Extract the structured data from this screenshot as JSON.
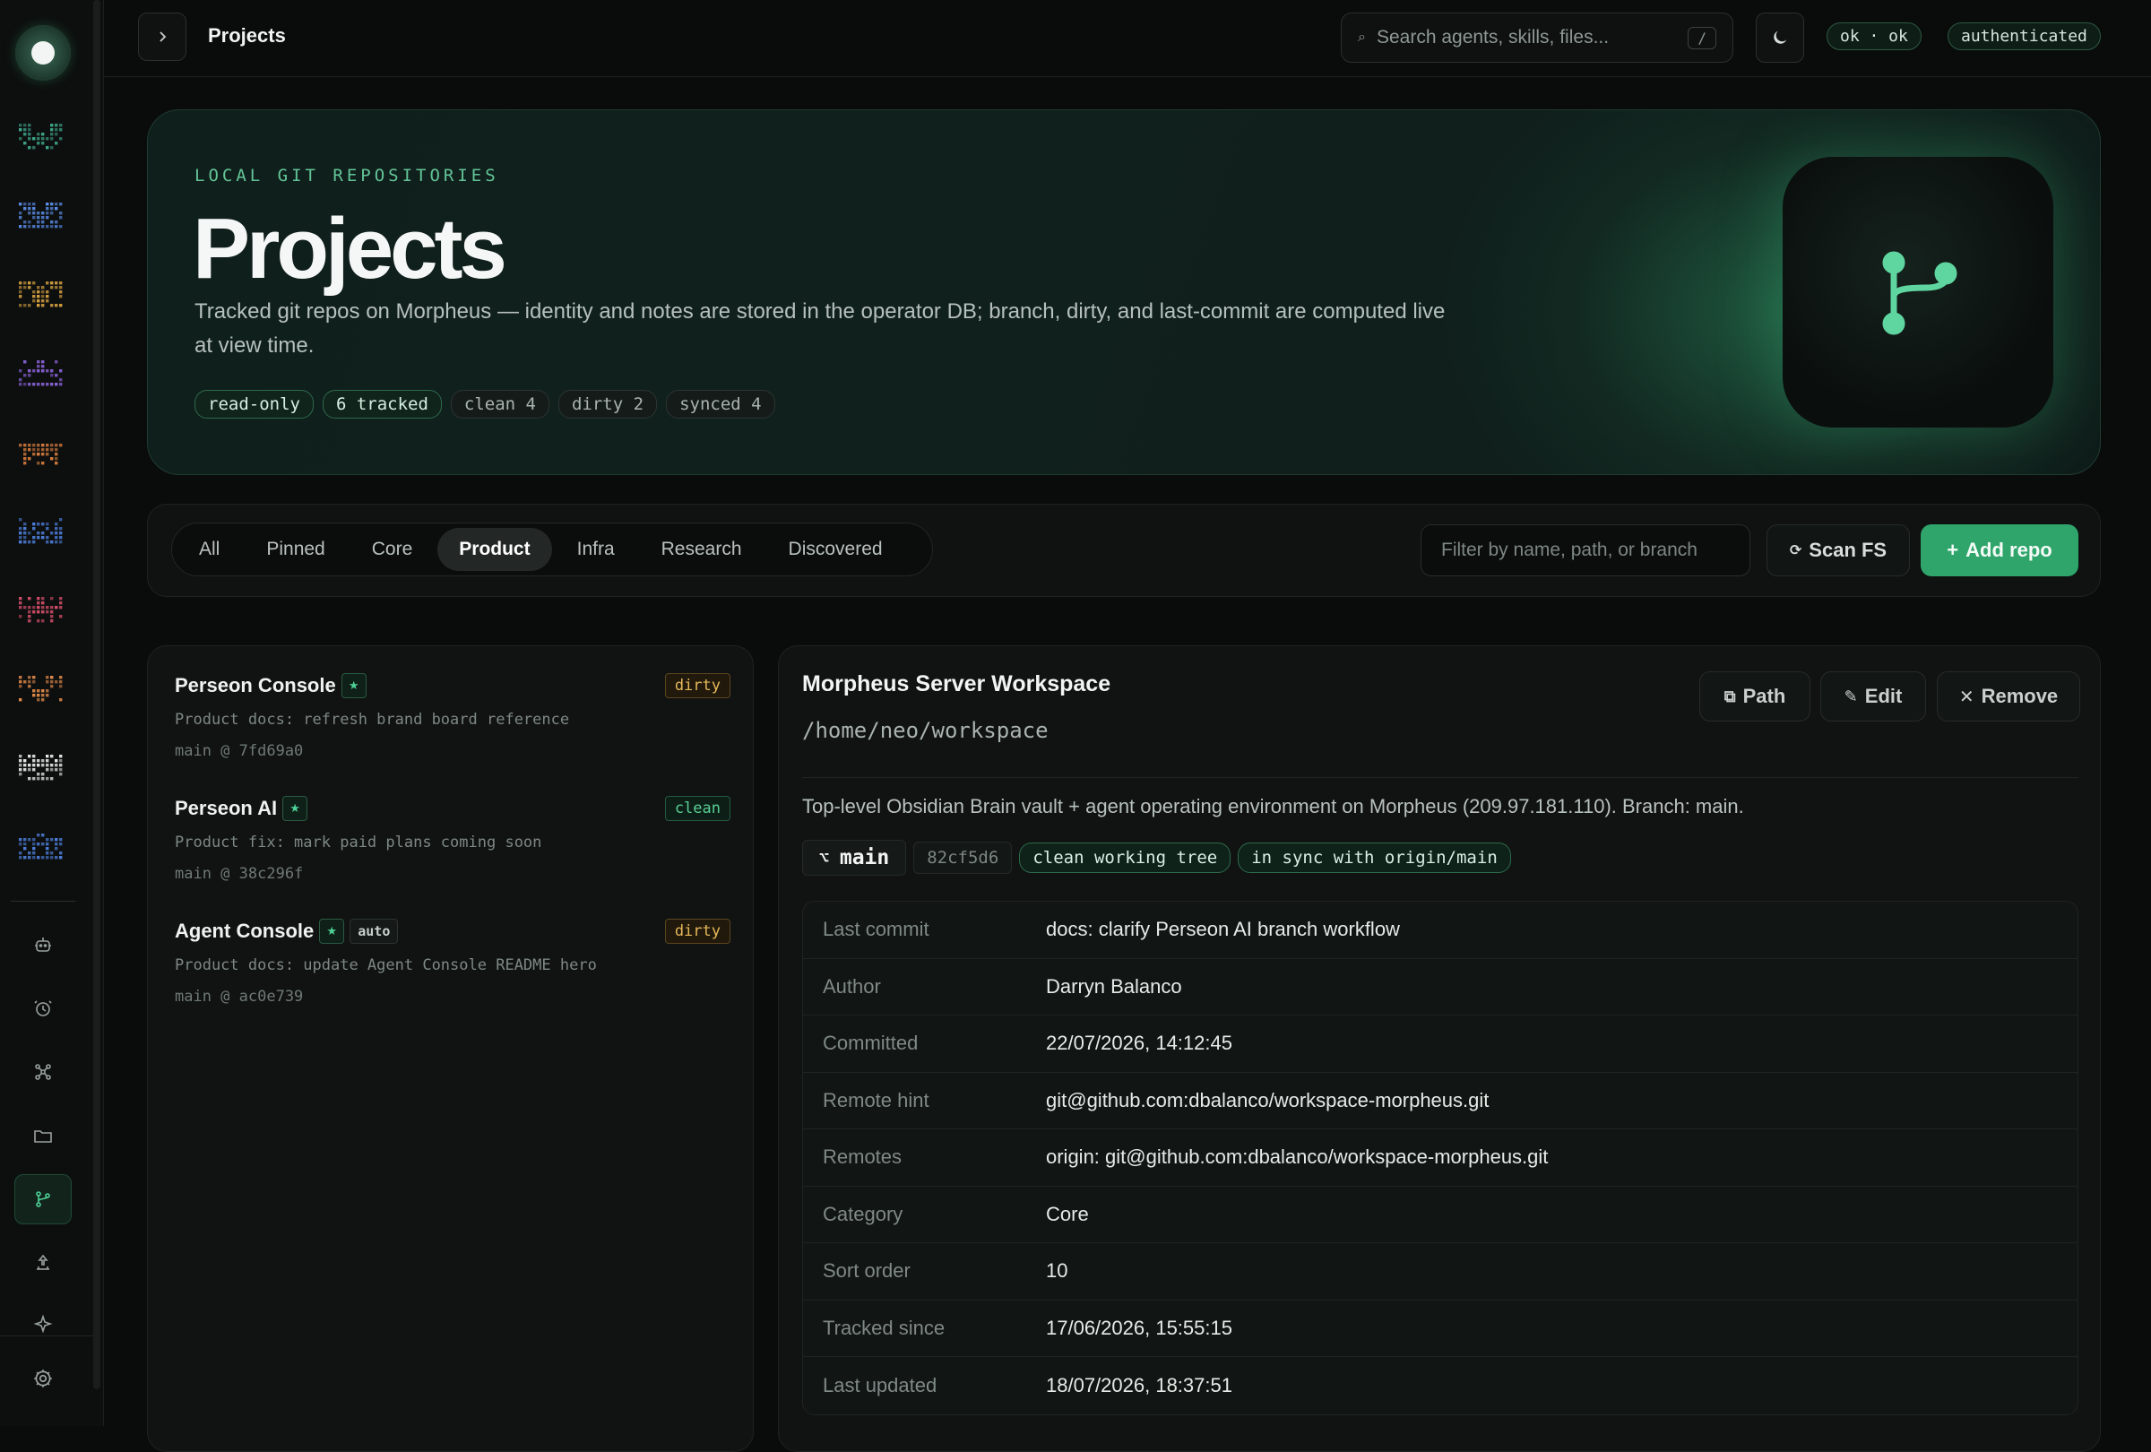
{
  "topbar": {
    "title": "Projects",
    "search_placeholder": "Search agents, skills, files...",
    "search_shortcut": "/",
    "status_ok": "ok · ok",
    "status_auth": "authenticated"
  },
  "hero": {
    "eyebrow": "LOCAL GIT REPOSITORIES",
    "title": "Projects",
    "description": "Tracked git repos on Morpheus — identity and notes are stored in the operator DB; branch, dirty, and last-commit are computed live at view time.",
    "chips": [
      "read-only",
      "6 tracked",
      "clean 4",
      "dirty 2",
      "synced 4"
    ]
  },
  "filters": {
    "tabs": [
      "All",
      "Pinned",
      "Core",
      "Product",
      "Infra",
      "Research",
      "Discovered"
    ],
    "active_tab": "Product",
    "filter_placeholder": "Filter by name, path, or branch",
    "scan_label": "Scan FS",
    "add_label": "Add repo"
  },
  "repos": [
    {
      "name": "Perseon Console",
      "star": "★",
      "status": "dirty",
      "message": "Product docs: refresh brand board reference",
      "branch": "main @ 7fd69a0"
    },
    {
      "name": "Perseon AI",
      "star": "★",
      "status": "clean",
      "message": "Product fix: mark paid plans coming soon",
      "branch": "main @ 38c296f"
    },
    {
      "name": "Agent Console",
      "star": "★",
      "tag": "auto",
      "status": "dirty",
      "message": "Product docs: update Agent Console README hero",
      "branch": "main @ ac0e739"
    }
  ],
  "detail": {
    "title": "Morpheus Server Workspace",
    "path": "/home/neo/workspace",
    "actions": {
      "path": "Path",
      "edit": "Edit",
      "remove": "Remove"
    },
    "description": "Top-level Obsidian Brain vault + agent operating environment on Morpheus (209.97.181.110). Branch: main.",
    "branch": "main",
    "sha": "82cf5d6",
    "tree_status": "clean working tree",
    "sync_status": "in sync with origin/main",
    "rows": [
      {
        "key": "Last commit",
        "value": "docs: clarify Perseon AI branch workflow"
      },
      {
        "key": "Author",
        "value": "Darryn Balanco"
      },
      {
        "key": "Committed",
        "value": "22/07/2026, 14:12:45"
      },
      {
        "key": "Remote hint",
        "value": "git@github.com:dbalanco/workspace-morpheus.git"
      },
      {
        "key": "Remotes",
        "value": "origin: git@github.com:dbalanco/workspace-morpheus.git"
      },
      {
        "key": "Category",
        "value": "Core"
      },
      {
        "key": "Sort order",
        "value": "10"
      },
      {
        "key": "Tracked since",
        "value": "17/06/2026, 15:55:15"
      },
      {
        "key": "Last updated",
        "value": "18/07/2026, 18:37:51"
      }
    ]
  },
  "colors": {
    "accent": "#2fa56b",
    "accent_text": "#4ed196",
    "dirty": "#e5b95a",
    "clean": "#58cf95",
    "agent_tiles": [
      "#3fa88a",
      "#5b8ee8",
      "#d9a441",
      "#8a63d8",
      "#e0813f",
      "#4d7fdc",
      "#d9506b",
      "#e08a4a",
      "#e6e9e8",
      "#4d7fdc"
    ]
  },
  "icons": {
    "sidebar": [
      "robot-icon",
      "clock-icon",
      "network-icon",
      "folder-icon",
      "git-branch-icon",
      "upload-icon",
      "sparkle-icon",
      "settings-icon"
    ]
  }
}
